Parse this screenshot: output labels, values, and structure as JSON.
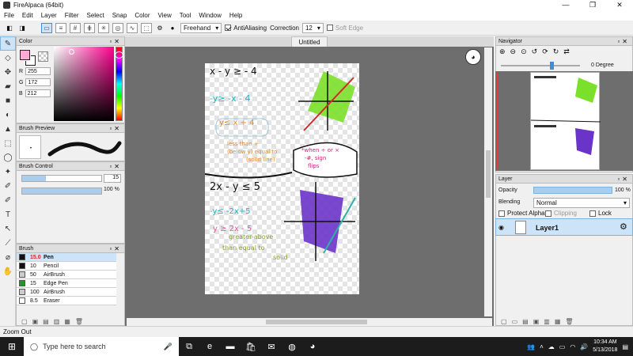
{
  "window": {
    "title": "FireAlpaca (64bit)",
    "min": "—",
    "max": "❐",
    "close": "✕"
  },
  "menu": [
    "File",
    "Edit",
    "Layer",
    "Filter",
    "Select",
    "Snap",
    "Color",
    "View",
    "Tool",
    "Window",
    "Help"
  ],
  "toolbar": {
    "mode": "Freehand",
    "antialias": "AntiAliasing",
    "correction_label": "Correction",
    "correction_value": "12",
    "soft_edge": "Soft Edge"
  },
  "color": {
    "title": "Color",
    "r_label": "R",
    "r": "255",
    "g_label": "G",
    "g": "172",
    "b_label": "B",
    "b": "212",
    "fg": "#ffacd4"
  },
  "brush_preview": {
    "title": "Brush Preview",
    "marker": "•"
  },
  "brush_control": {
    "title": "Brush Control",
    "size": "15",
    "size_fraction": 0.3,
    "opacity": "100 %",
    "opacity_fraction": 1.0
  },
  "brush_list": {
    "title": "Brush",
    "items": [
      {
        "size": "15.0",
        "name": "Pen",
        "color": "#111111"
      },
      {
        "size": "10",
        "name": "Pencil",
        "color": "#111111"
      },
      {
        "size": "50",
        "name": "AirBrush",
        "color": "#cccccc"
      },
      {
        "size": "15",
        "name": "Edge Pen",
        "color": "#1e9b1e"
      },
      {
        "size": "100",
        "name": "AirBrush",
        "color": "#cccccc"
      },
      {
        "size": "8.5",
        "name": "Eraser",
        "color": "#ffffff"
      }
    ]
  },
  "canvas": {
    "tab": "Untitled"
  },
  "navigator": {
    "title": "Navigator",
    "zoom": "0 Degree"
  },
  "layer_panel": {
    "title": "Layer",
    "opacity_label": "Opacity",
    "opacity_value": "100 %",
    "blending_label": "Blending",
    "blending_value": "Normal",
    "protect_alpha": "Protect Alpha",
    "clipping": "Clipping",
    "lock": "Lock",
    "layer_name": "Layer1"
  },
  "status": {
    "text": "Zoom Out"
  },
  "taskbar": {
    "search_placeholder": "Type here to search",
    "time": "10:34 AM",
    "date": "5/13/2018"
  }
}
